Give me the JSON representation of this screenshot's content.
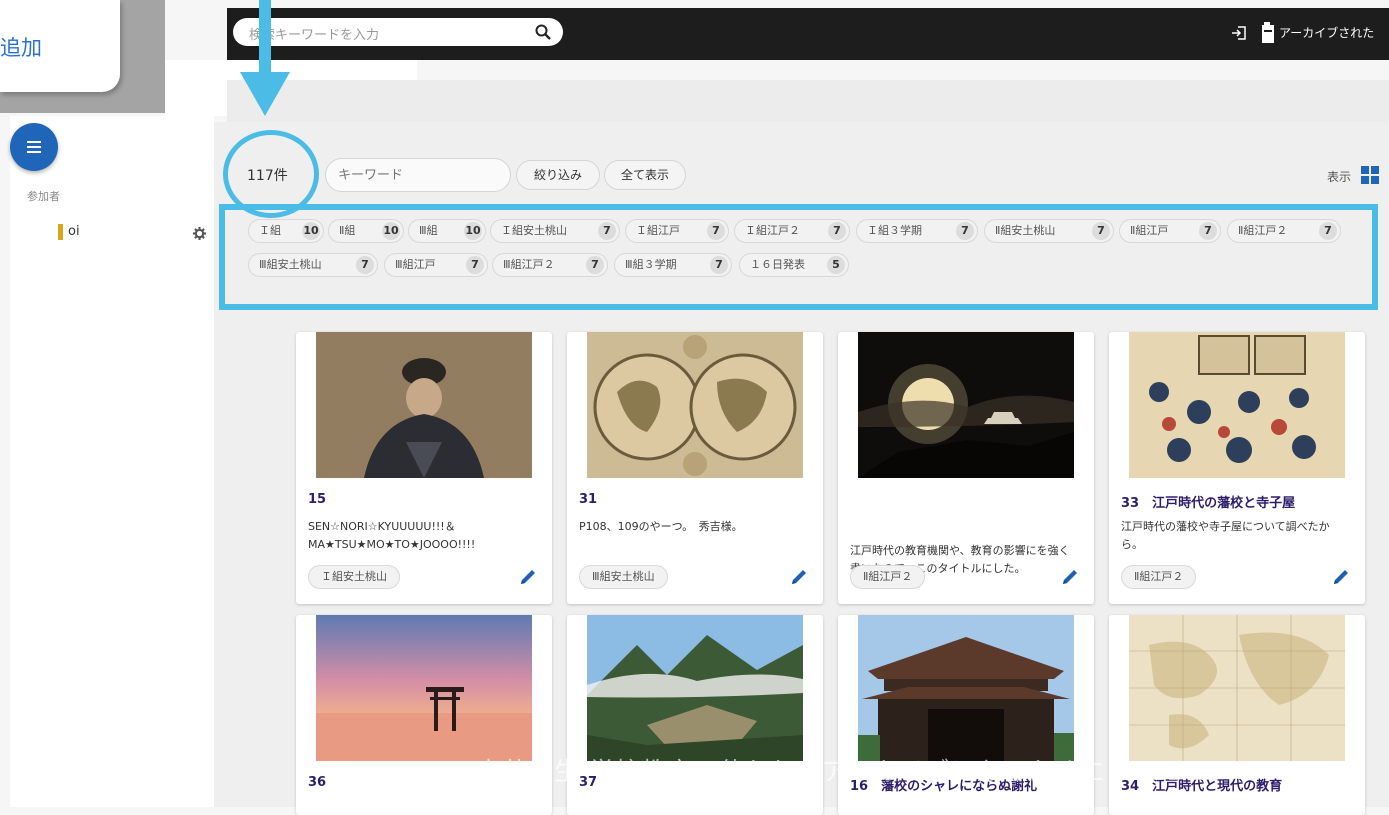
{
  "overlay": {
    "add_label": "追加"
  },
  "header": {
    "search_placeholder": "検索キーワードを入力",
    "archive_label": "アーカイブされた"
  },
  "sidebar": {
    "participants_label": "参加者",
    "participant": {
      "name": "oi",
      "color": "#d7a51c"
    }
  },
  "toolbar": {
    "count": "117件",
    "keyword_placeholder": "キーワード",
    "filter_label": "絞り込み",
    "show_all_label": "全て表示",
    "view_label": "表示"
  },
  "tags": [
    {
      "label": "Ｉ組",
      "count": "10"
    },
    {
      "label": "Ⅱ組",
      "count": "10"
    },
    {
      "label": "Ⅲ組",
      "count": "10"
    },
    {
      "label": "Ｉ組安土桃山",
      "count": "7"
    },
    {
      "label": "Ｉ組江戸",
      "count": "7"
    },
    {
      "label": "Ｉ組江戸２",
      "count": "7"
    },
    {
      "label": "Ｉ組３学期",
      "count": "7"
    },
    {
      "label": "Ⅱ組安土桃山",
      "count": "7"
    },
    {
      "label": "Ⅱ組江戸",
      "count": "7"
    },
    {
      "label": "Ⅱ組江戸２",
      "count": "7"
    },
    {
      "label": "Ⅲ組安土桃山",
      "count": "7"
    },
    {
      "label": "Ⅲ組江戸",
      "count": "7"
    },
    {
      "label": "Ⅲ組江戸２",
      "count": "7"
    },
    {
      "label": "Ⅲ組３学期",
      "count": "7"
    },
    {
      "label": "１６日発表",
      "count": "5"
    }
  ],
  "cards": [
    {
      "title": "15",
      "desc": "SEN☆NORI☆KYUUUUU!!!＆ MA★TSU★MO★TO★JOOOO!!!!",
      "tag": "Ｉ組安土桃山"
    },
    {
      "title": "31",
      "desc": "P108、109のやーつ。　秀吉様。",
      "tag": "Ⅲ組安土桃山"
    },
    {
      "title": "",
      "desc": "江戸時代の教育機関や、教育の影響にを強く書いたので、このタイトルにした。",
      "tag": "Ⅱ組江戸２"
    },
    {
      "title": "33　江戸時代の藩校と寺子屋",
      "desc": "江戸時代の藩校や寺子屋について調べたから。",
      "tag": "Ⅱ組江戸２"
    },
    {
      "title": "36"
    },
    {
      "title": "37"
    },
    {
      "title": "16　藩校のシャレにならぬ謝礼"
    },
    {
      "title": "34　江戸時代と現代の教育"
    }
  ],
  "watermark": "大井将生 学校教育で使われるアーカイブになるために 2021-2",
  "colors": {
    "highlight": "#4bbce6",
    "menu_button": "#1f66b8",
    "card_title": "#2d1e6b",
    "edit_icon": "#1f5fb4"
  }
}
